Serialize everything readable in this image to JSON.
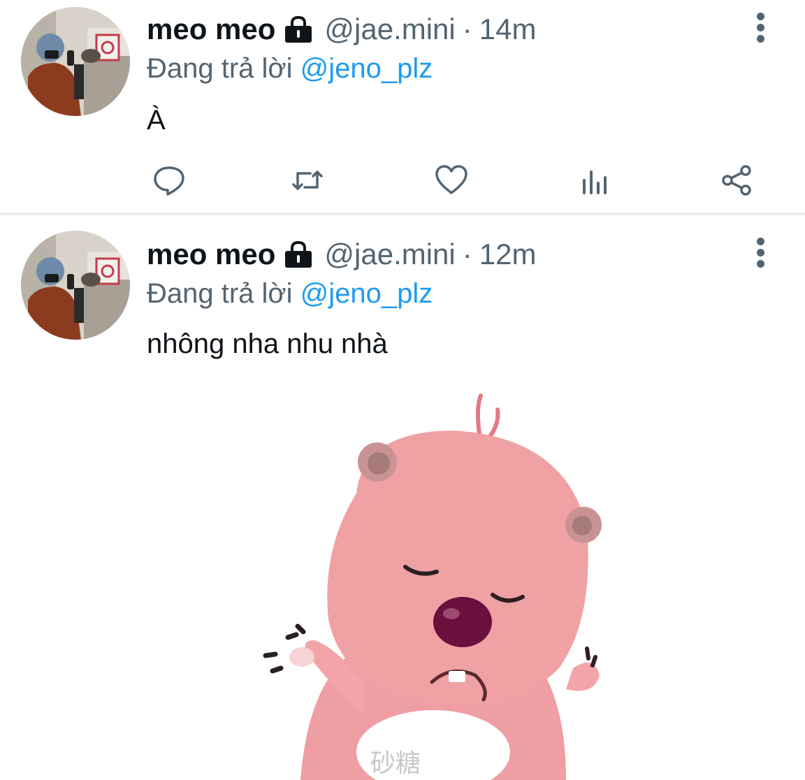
{
  "tweets": [
    {
      "author_name": "meo meo",
      "handle": "@jae.mini",
      "separator": "·",
      "time": "14m",
      "reply_prefix": "Đang trả lời ",
      "reply_mention": "@jeno_plz",
      "text": "À",
      "has_media": false
    },
    {
      "author_name": "meo meo",
      "handle": "@jae.mini",
      "separator": "·",
      "time": "12m",
      "reply_prefix": "Đang trả lời ",
      "reply_mention": "@jeno_plz",
      "text": "nhông nha nhu nhà",
      "has_media": true,
      "media": {
        "watermark": "砂糖"
      }
    }
  ],
  "icons": {
    "avatar": "avatar-image",
    "lock": "lock-icon",
    "more": "more-vertical-icon",
    "reply": "reply-icon",
    "retweet": "retweet-icon",
    "like": "heart-icon",
    "stats": "analytics-icon",
    "share": "share-icon"
  },
  "colors": {
    "text": "#0f1419",
    "secondary": "#536471",
    "mention": "#1d9bf0",
    "divider": "#e6ecf0",
    "character": "#f0a1a4"
  }
}
